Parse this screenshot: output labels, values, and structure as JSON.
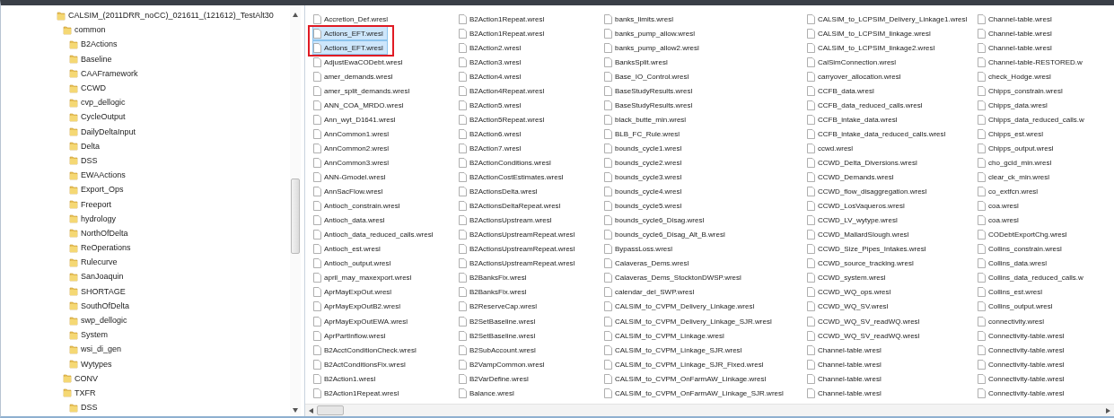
{
  "folder_tree": [
    {
      "name": "CALSIM_(2011DRR_noCC)_021611_(121612)_TestAlt30",
      "children": [
        {
          "name": "common",
          "children": [
            {
              "name": "B2Actions"
            },
            {
              "name": "Baseline"
            },
            {
              "name": "CAAFramework"
            },
            {
              "name": "CCWD"
            },
            {
              "name": "cvp_dellogic"
            },
            {
              "name": "CycleOutput"
            },
            {
              "name": "DailyDeltaInput"
            },
            {
              "name": "Delta"
            },
            {
              "name": "DSS"
            },
            {
              "name": "EWAActions"
            },
            {
              "name": "Export_Ops"
            },
            {
              "name": "Freeport"
            },
            {
              "name": "hydrology"
            },
            {
              "name": "NorthOfDelta"
            },
            {
              "name": "ReOperations"
            },
            {
              "name": "Rulecurve"
            },
            {
              "name": "SanJoaquin"
            },
            {
              "name": "SHORTAGE"
            },
            {
              "name": "SouthOfDelta"
            },
            {
              "name": "swp_dellogic"
            },
            {
              "name": "System"
            },
            {
              "name": "wsi_di_gen"
            },
            {
              "name": "Wytypes"
            }
          ]
        },
        {
          "name": "CONV"
        },
        {
          "name": "TXFR",
          "children": [
            {
              "name": "DSS"
            }
          ]
        }
      ]
    }
  ],
  "files": [
    {
      "name": "Accretion_Def.wresl",
      "selected": false
    },
    {
      "name": "Actions_EFT.wresl",
      "selected": true
    },
    {
      "name": "Actions_EFT.wresl",
      "selected": true
    },
    {
      "name": "AdjustEwaCODebt.wresl",
      "selected": false
    },
    {
      "name": "amer_demands.wresl",
      "selected": false
    },
    {
      "name": "amer_split_demands.wresl",
      "selected": false
    },
    {
      "name": "ANN_COA_MRDO.wresl",
      "selected": false
    },
    {
      "name": "Ann_wyt_D1641.wresl",
      "selected": false
    },
    {
      "name": "AnnCommon1.wresl",
      "selected": false
    },
    {
      "name": "AnnCommon2.wresl",
      "selected": false
    },
    {
      "name": "AnnCommon3.wresl",
      "selected": false
    },
    {
      "name": "ANN-Gmodel.wresl",
      "selected": false
    },
    {
      "name": "AnnSacFlow.wresl",
      "selected": false
    },
    {
      "name": "Antioch_constrain.wresl",
      "selected": false
    },
    {
      "name": "Antioch_data.wresl",
      "selected": false
    },
    {
      "name": "Antioch_data_reduced_calls.wresl",
      "selected": false
    },
    {
      "name": "Antioch_est.wresl",
      "selected": false
    },
    {
      "name": "Antioch_output.wresl",
      "selected": false
    },
    {
      "name": "april_may_maxexport.wresl",
      "selected": false
    },
    {
      "name": "AprMayExpOut.wresl",
      "selected": false
    },
    {
      "name": "AprMayExpOutB2.wresl",
      "selected": false
    },
    {
      "name": "AprMayExpOutEWA.wresl",
      "selected": false
    },
    {
      "name": "AprPartInflow.wresl",
      "selected": false
    },
    {
      "name": "B2AcctConditionCheck.wresl",
      "selected": false
    },
    {
      "name": "B2ActConditionsFix.wresl",
      "selected": false
    },
    {
      "name": "B2Action1.wresl",
      "selected": false
    },
    {
      "name": "B2Action1Repeat.wresl",
      "selected": false
    },
    {
      "name": "B2Action1Repeat.wresl",
      "selected": false
    },
    {
      "name": "B2Action1Repeat.wresl",
      "selected": false
    },
    {
      "name": "B2Action2.wresl",
      "selected": false
    },
    {
      "name": "B2Action3.wresl",
      "selected": false
    },
    {
      "name": "B2Action4.wresl",
      "selected": false
    },
    {
      "name": "B2Action4Repeat.wresl",
      "selected": false
    },
    {
      "name": "B2Action5.wresl",
      "selected": false
    },
    {
      "name": "B2Action5Repeat.wresl",
      "selected": false
    },
    {
      "name": "B2Action6.wresl",
      "selected": false
    },
    {
      "name": "B2Action7.wresl",
      "selected": false
    },
    {
      "name": "B2ActionConditions.wresl",
      "selected": false
    },
    {
      "name": "B2ActionCostEstimates.wresl",
      "selected": false
    },
    {
      "name": "B2ActionsDelta.wresl",
      "selected": false
    },
    {
      "name": "B2ActionsDeltaRepeat.wresl",
      "selected": false
    },
    {
      "name": "B2ActionsUpstream.wresl",
      "selected": false
    },
    {
      "name": "B2ActionsUpstreamRepeat.wresl",
      "selected": false
    },
    {
      "name": "B2ActionsUpstreamRepeat.wresl",
      "selected": false
    },
    {
      "name": "B2ActionsUpstreamRepeat.wresl",
      "selected": false
    },
    {
      "name": "B2BanksFix.wresl",
      "selected": false
    },
    {
      "name": "B2BanksFix.wresl",
      "selected": false
    },
    {
      "name": "B2ReserveCap.wresl",
      "selected": false
    },
    {
      "name": "B2SetBaseline.wresl",
      "selected": false
    },
    {
      "name": "B2SetBaseline.wresl",
      "selected": false
    },
    {
      "name": "B2SubAccount.wresl",
      "selected": false
    },
    {
      "name": "B2VampCommon.wresl",
      "selected": false
    },
    {
      "name": "B2VarDefine.wresl",
      "selected": false
    },
    {
      "name": "Balance.wresl",
      "selected": false
    },
    {
      "name": "banks_limits.wresl",
      "selected": false
    },
    {
      "name": "banks_pump_allow.wresl",
      "selected": false
    },
    {
      "name": "banks_pump_allow2.wresl",
      "selected": false
    },
    {
      "name": "BanksSplit.wresl",
      "selected": false
    },
    {
      "name": "Base_IO_Control.wresl",
      "selected": false
    },
    {
      "name": "BaseStudyResults.wresl",
      "selected": false
    },
    {
      "name": "BaseStudyResults.wresl",
      "selected": false
    },
    {
      "name": "black_butte_min.wresl",
      "selected": false
    },
    {
      "name": "BLB_FC_Rule.wresl",
      "selected": false
    },
    {
      "name": "bounds_cycle1.wresl",
      "selected": false
    },
    {
      "name": "bounds_cycle2.wresl",
      "selected": false
    },
    {
      "name": "bounds_cycle3.wresl",
      "selected": false
    },
    {
      "name": "bounds_cycle4.wresl",
      "selected": false
    },
    {
      "name": "bounds_cycle5.wresl",
      "selected": false
    },
    {
      "name": "bounds_cycle6_Disag.wresl",
      "selected": false
    },
    {
      "name": "bounds_cycle6_Disag_Alt_B.wresl",
      "selected": false
    },
    {
      "name": "BypassLoss.wresl",
      "selected": false
    },
    {
      "name": "Calaveras_Dems.wresl",
      "selected": false
    },
    {
      "name": "Calaveras_Dems_StocktonDWSP.wresl",
      "selected": false
    },
    {
      "name": "calendar_del_SWP.wresl",
      "selected": false
    },
    {
      "name": "CALSIM_to_CVPM_Delivery_Linkage.wresl",
      "selected": false
    },
    {
      "name": "CALSIM_to_CVPM_Delivery_Linkage_SJR.wresl",
      "selected": false
    },
    {
      "name": "CALSIM_to_CVPM_Linkage.wresl",
      "selected": false
    },
    {
      "name": "CALSIM_to_CVPM_Linkage_SJR.wresl",
      "selected": false
    },
    {
      "name": "CALSIM_to_CVPM_Linkage_SJR_Fixed.wresl",
      "selected": false
    },
    {
      "name": "CALSIM_to_CVPM_OnFarmAW_Linkage.wresl",
      "selected": false
    },
    {
      "name": "CALSIM_to_CVPM_OnFarmAW_Linkage_SJR.wresl",
      "selected": false
    },
    {
      "name": "CALSIM_to_LCPSIM_Delivery_Linkage1.wresl",
      "selected": false
    },
    {
      "name": "CALSIM_to_LCPSIM_linkage.wresl",
      "selected": false
    },
    {
      "name": "CALSIM_to_LCPSIM_linkage2.wresl",
      "selected": false
    },
    {
      "name": "CalSimConnection.wresl",
      "selected": false
    },
    {
      "name": "carryover_allocation.wresl",
      "selected": false
    },
    {
      "name": "CCFB_data.wresl",
      "selected": false
    },
    {
      "name": "CCFB_data_reduced_calls.wresl",
      "selected": false
    },
    {
      "name": "CCFB_intake_data.wresl",
      "selected": false
    },
    {
      "name": "CCFB_intake_data_reduced_calls.wresl",
      "selected": false
    },
    {
      "name": "ccwd.wresl",
      "selected": false
    },
    {
      "name": "CCWD_Delta_Diversions.wresl",
      "selected": false
    },
    {
      "name": "CCWD_Demands.wresl",
      "selected": false
    },
    {
      "name": "CCWD_flow_disaggregation.wresl",
      "selected": false
    },
    {
      "name": "CCWD_LosVaqueros.wresl",
      "selected": false
    },
    {
      "name": "CCWD_LV_wytype.wresl",
      "selected": false
    },
    {
      "name": "CCWD_MallardSlough.wresl",
      "selected": false
    },
    {
      "name": "CCWD_Size_Pipes_Intakes.wresl",
      "selected": false
    },
    {
      "name": "CCWD_source_tracking.wresl",
      "selected": false
    },
    {
      "name": "CCWD_system.wresl",
      "selected": false
    },
    {
      "name": "CCWD_WQ_ops.wresl",
      "selected": false
    },
    {
      "name": "CCWD_WQ_SV.wresl",
      "selected": false
    },
    {
      "name": "CCWD_WQ_SV_readWQ.wresl",
      "selected": false
    },
    {
      "name": "CCWD_WQ_SV_readWQ.wresl",
      "selected": false
    },
    {
      "name": "Channel-table.wresl",
      "selected": false
    },
    {
      "name": "Channel-table.wresl",
      "selected": false
    },
    {
      "name": "Channel-table.wresl",
      "selected": false
    },
    {
      "name": "Channel-table.wresl",
      "selected": false
    },
    {
      "name": "Channel-table.wresl",
      "selected": false
    },
    {
      "name": "Channel-table.wresl",
      "selected": false
    },
    {
      "name": "Channel-table.wresl",
      "selected": false
    },
    {
      "name": "Channel-table-RESTORED.w",
      "selected": false
    },
    {
      "name": "check_Hodge.wresl",
      "selected": false
    },
    {
      "name": "Chipps_constrain.wresl",
      "selected": false
    },
    {
      "name": "Chipps_data.wresl",
      "selected": false
    },
    {
      "name": "Chipps_data_reduced_calls.w",
      "selected": false
    },
    {
      "name": "Chipps_est.wresl",
      "selected": false
    },
    {
      "name": "Chipps_output.wresl",
      "selected": false
    },
    {
      "name": "cho_gcid_min.wresl",
      "selected": false
    },
    {
      "name": "clear_ck_min.wresl",
      "selected": false
    },
    {
      "name": "co_extfcn.wresl",
      "selected": false
    },
    {
      "name": "coa.wresl",
      "selected": false
    },
    {
      "name": "coa.wresl",
      "selected": false
    },
    {
      "name": "CODebtExportChg.wresl",
      "selected": false
    },
    {
      "name": "Collins_constrain.wresl",
      "selected": false
    },
    {
      "name": "Collins_data.wresl",
      "selected": false
    },
    {
      "name": "Collins_data_reduced_calls.w",
      "selected": false
    },
    {
      "name": "Collins_est.wresl",
      "selected": false
    },
    {
      "name": "Collins_output.wresl",
      "selected": false
    },
    {
      "name": "connectivity.wresl",
      "selected": false
    },
    {
      "name": "Connectivity-table.wresl",
      "selected": false
    },
    {
      "name": "Connectivity-table.wresl",
      "selected": false
    },
    {
      "name": "Connectivity-table.wresl",
      "selected": false
    },
    {
      "name": "Connectivity-table.wresl",
      "selected": false
    },
    {
      "name": "Connectivity-table.wresl",
      "selected": false
    }
  ]
}
